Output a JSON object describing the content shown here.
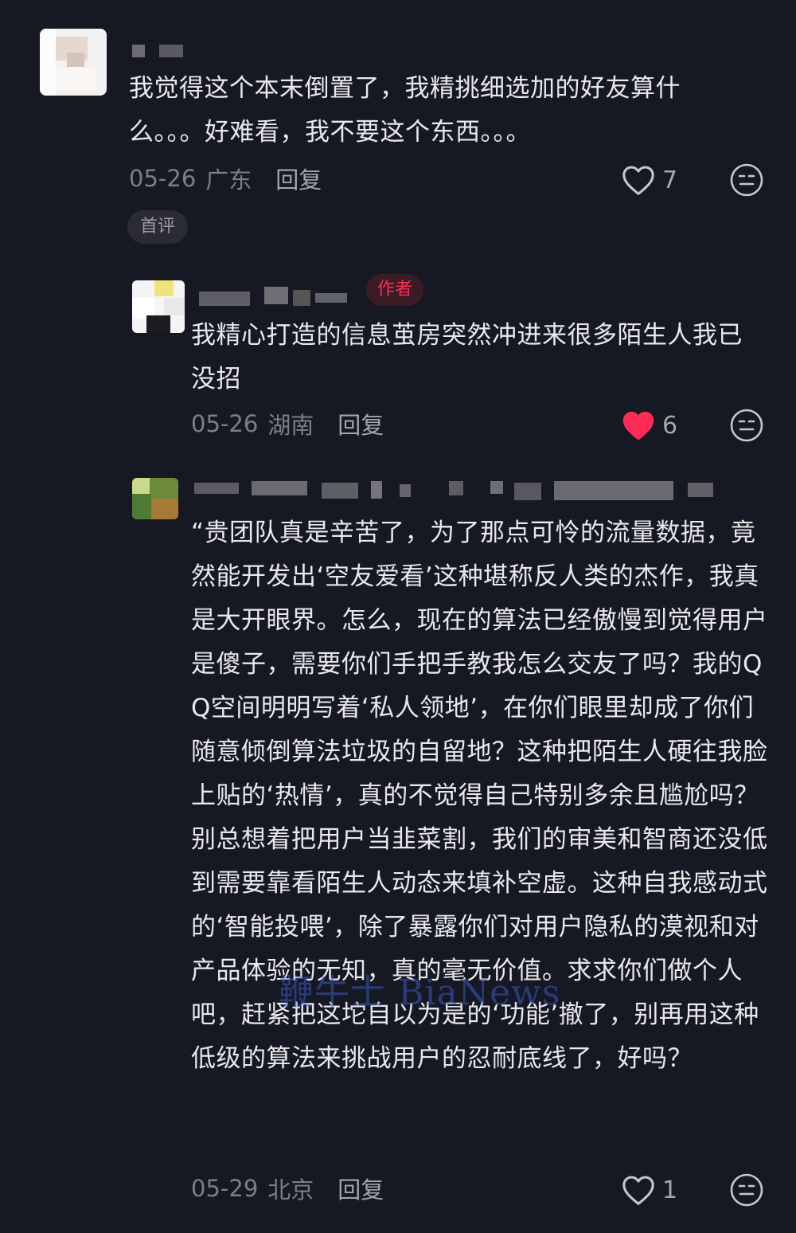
{
  "comments": [
    {
      "text": "我觉得这个本末倒置了，我精挑细选加的好友算什么。。。好难看，我不要这个东西。。。",
      "date": "05-26",
      "region": "广东",
      "reply_label": "回复",
      "likes": "7",
      "liked": false,
      "tag": "首评"
    },
    {
      "badge": "作者",
      "text": "我精心打造的信息茧房突然冲进来很多陌生人我已没招",
      "date": "05-26",
      "region": "湖南",
      "reply_label": "回复",
      "likes": "6",
      "liked": true
    },
    {
      "text": "“贵团队真是辛苦了，为了那点可怜的流量数据，竟然能开发出‘空友爱看’这种堪称反人类的杰作，我真是大开眼界。怎么，现在的算法已经傲慢到觉得用户是傻子，需要你们手把手教我怎么交友了吗？我的QQ空间明明写着‘私人领地’，在你们眼里却成了你们随意倾倒算法垃圾的自留地？这种把陌生人硬往我脸上贴的‘热情’，真的不觉得自己特别多余且尴尬吗？别总想着把用户当韭菜割，我们的审美和智商还没低到需要靠看陌生人动态来填补空虚。这种自我感动式的‘智能投喂’，除了暴露你们对用户隐私的漠视和对产品体验的无知，真的毫无价值。求求你们做个人吧，赶紧把这坨自以为是的‘功能’撤了，别再用这种低级的算法来挑战用户的忍耐底线了，好吗？",
      "date": "05-29",
      "region": "北京",
      "reply_label": "回复",
      "likes": "1",
      "liked": false
    }
  ],
  "watermark": "鞭牛士 BiaNews",
  "colors": {
    "background": "#161823",
    "liked_heart": "#fe2c55",
    "author_badge": "#fe2c55"
  },
  "icons": [
    "heart-outline-icon",
    "heart-filled-icon",
    "emoji-icon"
  ]
}
